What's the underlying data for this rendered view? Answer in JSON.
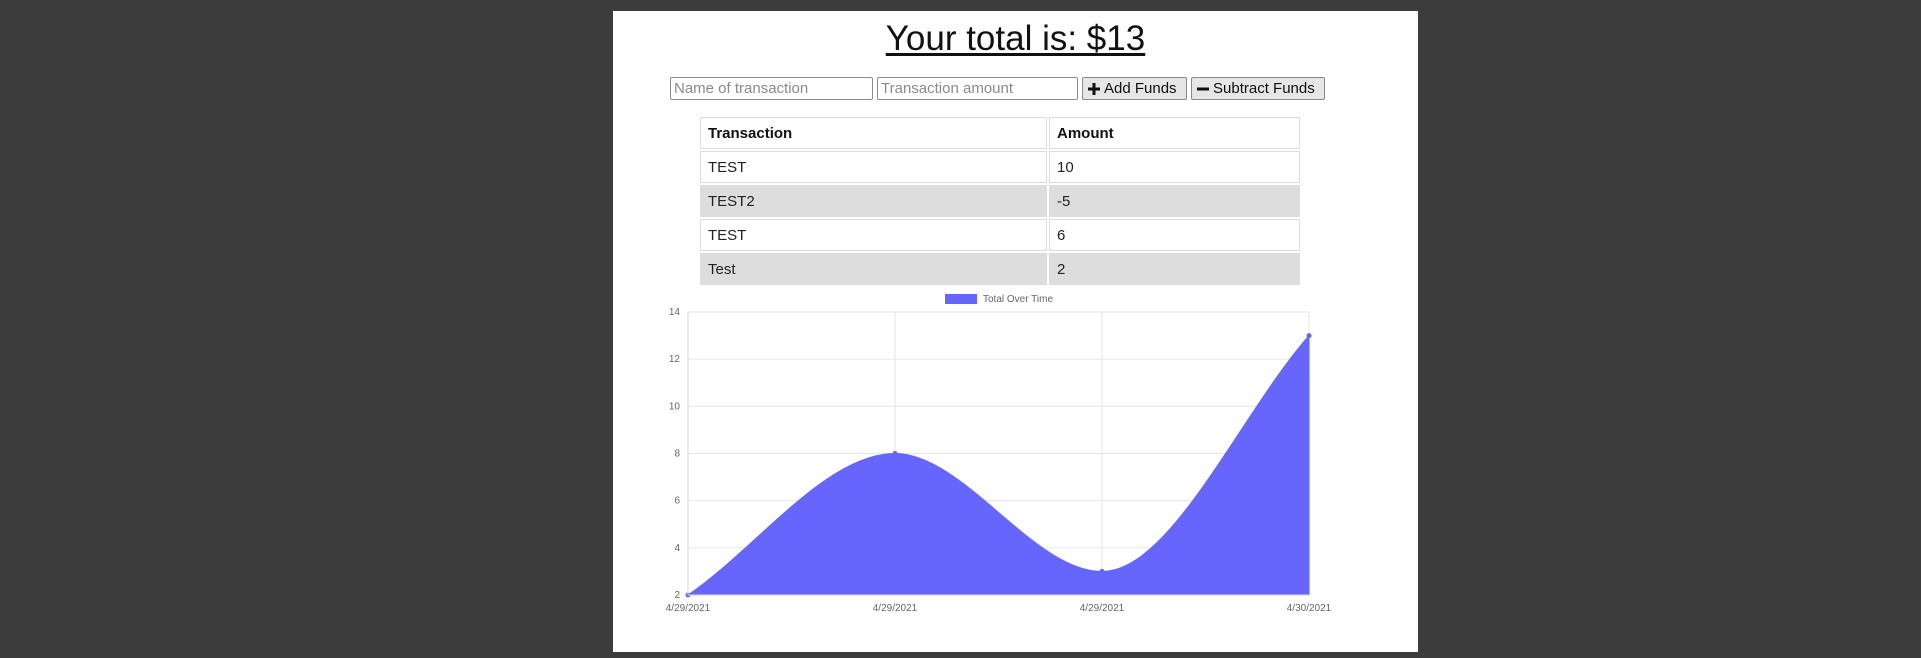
{
  "header": {
    "title": "Your total is: $13"
  },
  "form": {
    "name_placeholder": "Name of transaction",
    "amount_placeholder": "Transaction amount",
    "add_label": "Add Funds",
    "subtract_label": "Subtract Funds",
    "add_icon": "plus-icon",
    "subtract_icon": "minus-icon"
  },
  "table": {
    "headers": [
      "Transaction",
      "Amount"
    ],
    "rows": [
      [
        "TEST",
        "10"
      ],
      [
        "TEST2",
        "-5"
      ],
      [
        "TEST",
        "6"
      ],
      [
        "Test",
        "2"
      ]
    ]
  },
  "chart_data": {
    "type": "area",
    "legend": "Total Over Time",
    "legend_position": "top",
    "categories": [
      "4/29/2021",
      "4/29/2021",
      "4/29/2021",
      "4/30/2021"
    ],
    "series": [
      {
        "name": "Total Over Time",
        "values": [
          2,
          8,
          3,
          13
        ]
      }
    ],
    "ylim": [
      2,
      14
    ],
    "yticks": [
      2,
      4,
      6,
      8,
      10,
      12,
      14
    ],
    "grid": true,
    "smooth": true,
    "color": "#6666ff"
  }
}
